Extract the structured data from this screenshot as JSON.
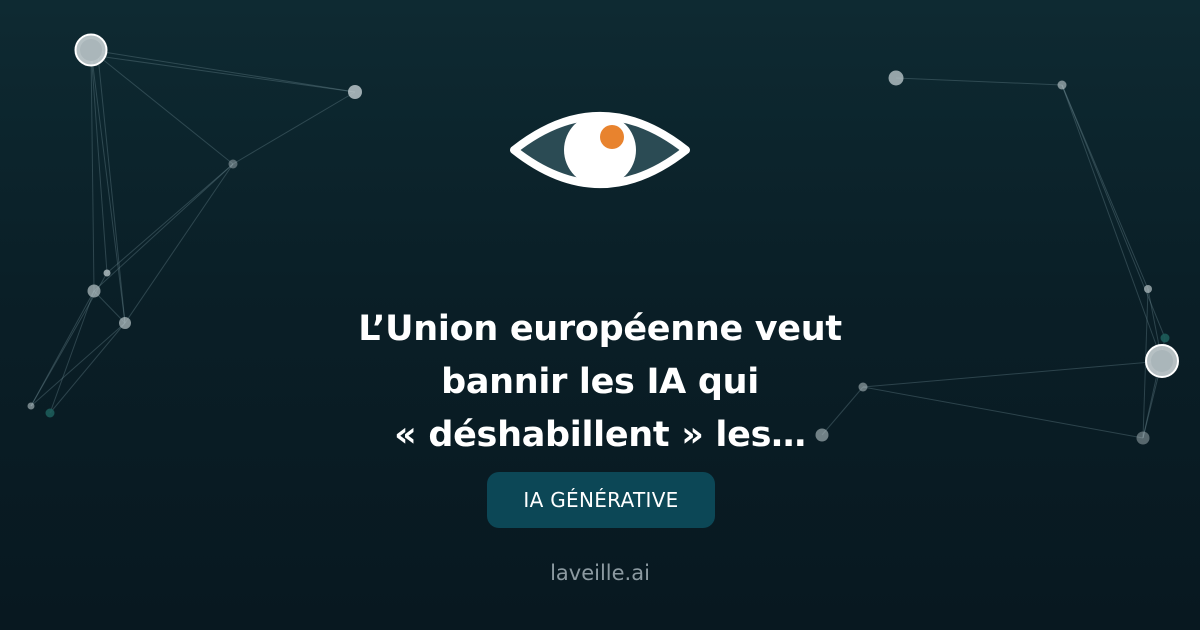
{
  "article": {
    "title_lines": [
      "L’Union européenne veut",
      "bannir les IA qui",
      "« déshabillent » les…"
    ],
    "category": "IA GÉNÉRATIVE"
  },
  "site": {
    "domain": "laveille.ai"
  },
  "logo": {
    "icon": "eye-icon"
  },
  "colors": {
    "background": "#0b222b",
    "accent": "#e8832e",
    "tag_background": "#0c4756",
    "text": "#ffffff",
    "muted_text": "#8c9aa1"
  }
}
